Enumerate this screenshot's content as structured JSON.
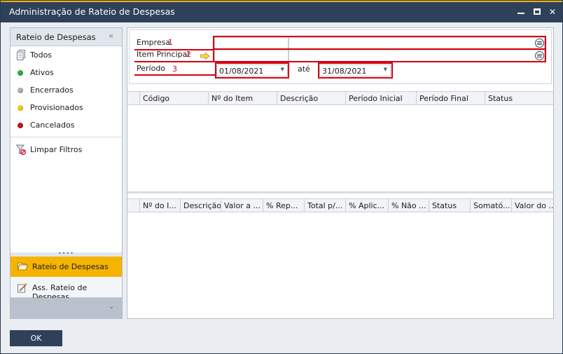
{
  "window": {
    "title": "Administração de Rateio de Despesas"
  },
  "sidebar": {
    "header": "Rateio de Despesas",
    "filters": [
      {
        "label": "Todos",
        "icon": "document-icon"
      },
      {
        "label": "Ativos",
        "icon": "green-dot-icon",
        "color": "#2fb344"
      },
      {
        "label": "Encerrados",
        "icon": "gray-dot-icon",
        "color": "#b3b3b3"
      },
      {
        "label": "Provisionados",
        "icon": "yellow-dot-icon",
        "color": "#f2d21c"
      },
      {
        "label": "Cancelados",
        "icon": "red-dot-icon",
        "color": "#c8181b"
      }
    ],
    "clear_filters": "Limpar Filtros",
    "nav": [
      {
        "label": "Rateio de Despesas",
        "icon": "folder-open-icon",
        "active": true
      },
      {
        "label": "Ass. Rateio de Despesas",
        "icon": "wizard-icon",
        "active": false
      }
    ]
  },
  "form": {
    "empresa": {
      "label": "Empresa",
      "marker": "1",
      "value": ""
    },
    "item_principal": {
      "label": "Item Principal",
      "marker": "2",
      "value": ""
    },
    "periodo": {
      "label": "Período",
      "marker": "3",
      "from": "01/08/2021",
      "to_label": "até",
      "to": "31/08/2021"
    }
  },
  "grid_top": {
    "columns": [
      "Código",
      "Nº do Item",
      "Descrição",
      "Período Inicial",
      "Período Final",
      "Status"
    ]
  },
  "grid_bottom": {
    "columns": [
      "Nº do I...",
      "Descrição",
      "Valor a ...",
      "% Rep...",
      "Total p/...",
      "% Aplic...",
      "% Não ...",
      "Status",
      "Somató...",
      "Valor do ..."
    ]
  },
  "footer": {
    "ok_label": "OK"
  },
  "colors": {
    "titlebar": "#2f405a",
    "accent": "#f4b400",
    "highlight": "#d60012"
  }
}
